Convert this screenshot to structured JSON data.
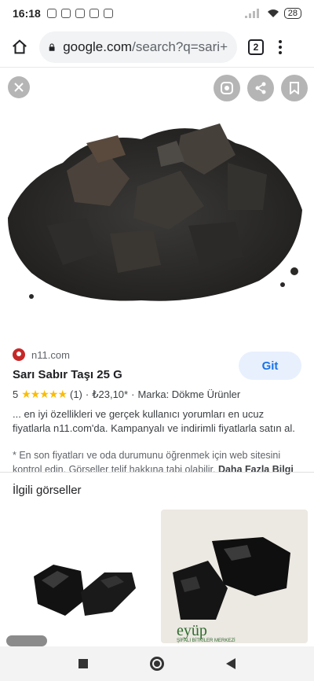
{
  "status_bar": {
    "time": "16:18",
    "battery": "28"
  },
  "browser": {
    "url_host": "google.com",
    "url_path": "/search?q=sari+",
    "tab_count": "2"
  },
  "result": {
    "source": "n11.com",
    "title": "Sarı Sabır Taşı 25 G",
    "button_label": "Git",
    "rating": "5",
    "stars": "★★★★★",
    "review_count": "(1)",
    "separator": "·",
    "price": "₺23,10*",
    "brand": "Marka: Dökme Ürünler",
    "description": "... en iyi özellikleri ve gerçek kullanıcı yorumları en ucuz fiyatlarla n11.com'da. Kampanyalı ve indirimli fiyatlarla satın al.",
    "disclaimer": "* En son fiyatları ve oda durumunu öğrenmek için web sitesini kontrol edin. Görseller telif hakkına tabi olabilir.",
    "more_link": "Daha Fazla Bilgi"
  },
  "related": {
    "heading": "İlgili görseller",
    "thumb2_logo": "eyüp",
    "thumb2_caption": "ŞİFALI BİTKİLER MERKEZİ"
  },
  "colors": {
    "accent": "#1a73e8",
    "button_bg": "#e8f0fe",
    "star": "#fbbc04"
  }
}
